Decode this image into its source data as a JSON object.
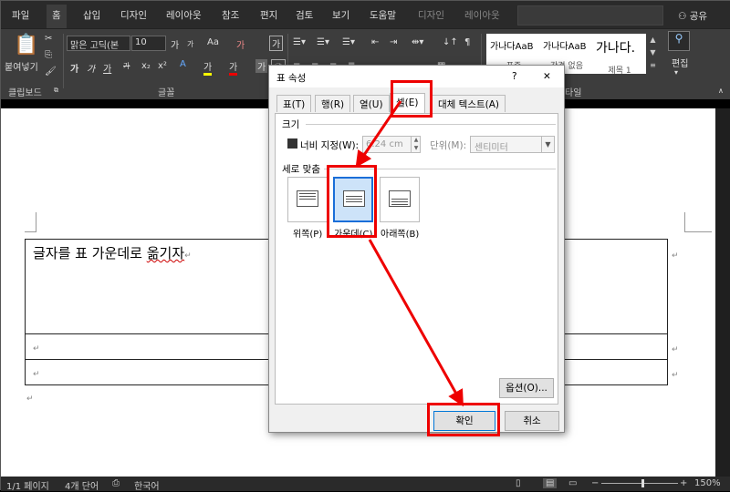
{
  "tabs": [
    "파일",
    "홈",
    "삽입",
    "디자인",
    "레이아웃",
    "참조",
    "편지",
    "검토",
    "보기",
    "도움말",
    "디자인",
    "레이아웃"
  ],
  "share": "공유",
  "ribbon": {
    "paste_label": "붙여넣기",
    "clipboard_label": "클립보드",
    "font_group_label": "글꼴",
    "font_name": "맑은 고딕(본",
    "font_size": "10",
    "grow_font": "가",
    "shrink_font": "가",
    "case": "Aa",
    "clear_fmt": "가",
    "char_border": "가",
    "bold": "가",
    "italic": "가",
    "underline": "가",
    "strike": "가",
    "subscript": "x₂",
    "superscript": "x²",
    "highlight": "가",
    "font_color": "가",
    "char_shade": "가",
    "style_group_label": "타일",
    "styles": [
      {
        "preview": "가나다AaB",
        "name": "표준"
      },
      {
        "preview": "가나다AaB",
        "name": "간격 없음"
      },
      {
        "preview": "가나다.",
        "name": "제목 1"
      }
    ],
    "edit_label": "편집"
  },
  "document": {
    "cell_text_main": "글자를 표 가운데로 ",
    "cell_text_squiggle": "옮기자",
    "para_mark": "↵"
  },
  "dialog": {
    "title": "표 속성",
    "help": "?",
    "close": "✕",
    "tabs": [
      "표(T)",
      "행(R)",
      "열(U)",
      "셀(E)",
      "대체 텍스트(A)"
    ],
    "size_section": "크기",
    "width_label": "너비 지정(W):",
    "width_value": "6.24 cm",
    "unit_label": "단위(M):",
    "unit_value": "센티미터",
    "valign_section": "세로 맞춤",
    "align_options": [
      "위쪽(P)",
      "가운데(C)",
      "아래쪽(B)"
    ],
    "selected_align": "가운데(C)",
    "options_button": "옵션(O)...",
    "ok_button": "확인",
    "cancel_button": "취소"
  },
  "status": {
    "page": "1/1 페이지",
    "words": "4개 단어",
    "language": "한국어",
    "zoom": "150%"
  },
  "colors": {
    "highlight_red": "#e00000",
    "accent_blue": "#1a6ed8"
  }
}
